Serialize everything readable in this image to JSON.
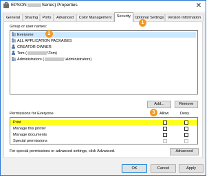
{
  "window": {
    "title_prefix": "EPSON",
    "title_suffix": "Series) Properties",
    "close_glyph": "✕"
  },
  "tabs": [
    {
      "label": "General"
    },
    {
      "label": "Sharing"
    },
    {
      "label": "Ports"
    },
    {
      "label": "Advanced"
    },
    {
      "label": "Color Management"
    },
    {
      "label": "Security",
      "active": true
    },
    {
      "label": "Optional Settings"
    },
    {
      "label": "Version Information"
    }
  ],
  "security": {
    "group_label": "Group or user names:",
    "users": [
      {
        "name": "Everyone",
        "icon": "group-icon",
        "selected": true
      },
      {
        "name": "ALL APPLICATION PACKAGES",
        "icon": "group-icon"
      },
      {
        "name": "CREATOR OWNER",
        "icon": "user-icon"
      },
      {
        "name_pre": "Tom (",
        "name_post": "\\Tom)",
        "icon": "user-icon"
      },
      {
        "name_pre": "Administrators (",
        "name_post": "\\Administrators)",
        "icon": "group-icon"
      }
    ],
    "add_label": "Add...",
    "remove_label": "Remove",
    "permissions_label": "Permissions for Everyone",
    "allow_label": "Allow",
    "deny_label": "Deny",
    "permissions": [
      {
        "name": "Print",
        "allow": false,
        "deny": false,
        "highlighted": true,
        "disabled": false
      },
      {
        "name": "Manage this printer",
        "allow": false,
        "deny": false,
        "disabled": false
      },
      {
        "name": "Manage documents",
        "allow": false,
        "deny": false,
        "disabled": false
      },
      {
        "name": "Special permissions",
        "allow": false,
        "deny": false,
        "disabled": true
      }
    ],
    "advanced_hint": "For special permissions or advanced settings, click Advanced.",
    "advanced_label": "Advanced"
  },
  "badges": [
    "1",
    "2",
    "3"
  ],
  "watermark": "www.wintips.org",
  "footer": {
    "ok_label": "OK",
    "cancel_label": "Cancel",
    "apply_label": "Apply"
  },
  "colors": {
    "accent": "#0078d7",
    "badge": "#f29a1f",
    "highlight": "#ffff1f",
    "selection": "#cce8ff"
  }
}
